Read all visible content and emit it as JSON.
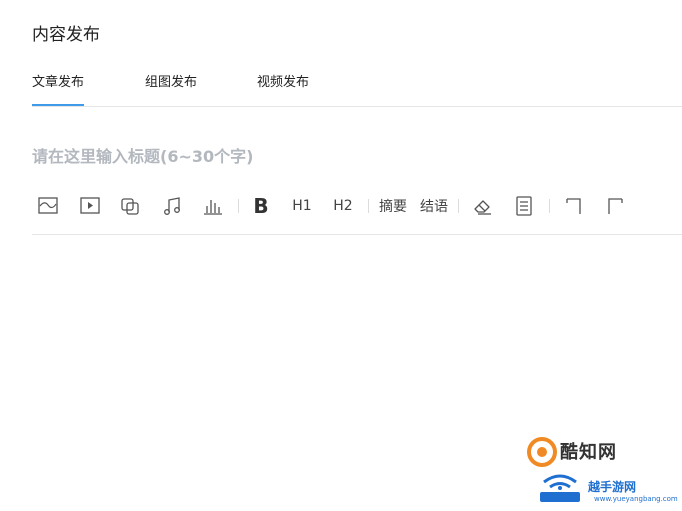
{
  "page_title": "内容发布",
  "tabs": [
    {
      "label": "文章发布",
      "active": true
    },
    {
      "label": "组图发布",
      "active": false
    },
    {
      "label": "视频发布",
      "active": false
    }
  ],
  "title_input": {
    "placeholder": "请在这里输入标题(6~30个字)",
    "value": ""
  },
  "toolbar": {
    "image": "image-icon",
    "video": "video-play-icon",
    "gallery": "gallery-icon",
    "music": "music-note-icon",
    "chart": "bar-chart-icon",
    "bold": "B",
    "h1": "H1",
    "h2": "H2",
    "summary": "摘要",
    "conclusion": "结语",
    "eraser": "eraser-icon",
    "document": "document-icon",
    "undo": "undo-icon",
    "redo": "redo-icon"
  },
  "watermark": {
    "name": "酷知网",
    "site": "越手游网",
    "url": "www.yueyangbang.com"
  },
  "colors": {
    "accent": "#3d9be9",
    "placeholder": "#b3b8bf",
    "divider": "#e6e6e6",
    "watermark_orange": "#f08a24",
    "watermark_blue": "#1f6fd1"
  }
}
